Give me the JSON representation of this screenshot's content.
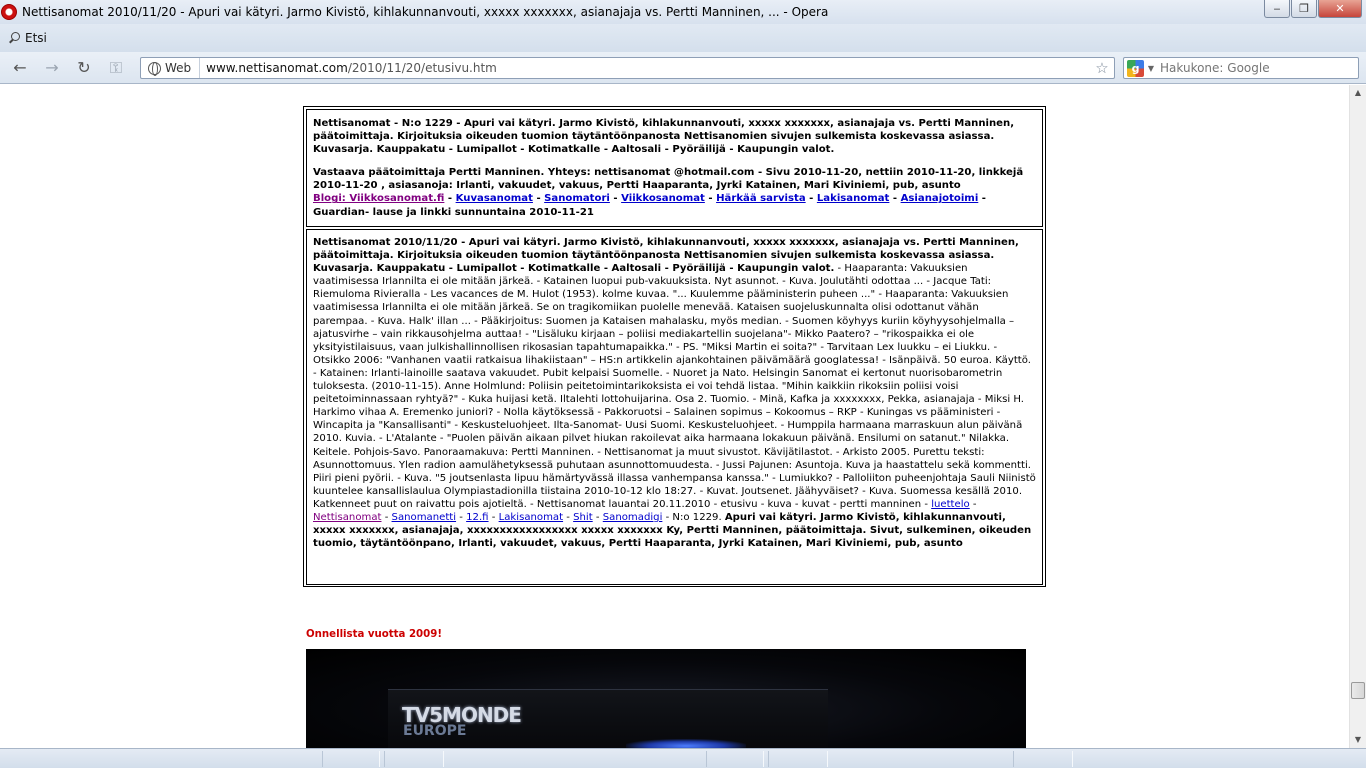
{
  "window": {
    "title": "Nettisanomat 2010/11/20 - Apuri vai kätyri. Jarmo Kivistö, kihlakunnanvouti, xxxxx xxxxxxx, asianajaja vs. Pertti Manninen, ... - Opera",
    "minimize": "‒",
    "restore": "❐",
    "close": "✕"
  },
  "menu": {
    "search_label": "Etsi"
  },
  "toolbar": {
    "back": "←",
    "forward": "→",
    "reload": "↻",
    "wand": "⚿",
    "web_label": "Web",
    "url_host": "www.nettisanomat.com",
    "url_path": "/2010/11/20/etusivu.htm",
    "star": "☆",
    "search_engine_letter": "g",
    "search_placeholder": "Hakukone: Google"
  },
  "page": {
    "box1": {
      "intro": "Nettisanomat - N:o 1229 - Apuri vai kätyri. Jarmo Kivistö, kihlakunnanvouti, xxxxx xxxxxxx, asianajaja vs. Pertti Manninen, päätoimittaja. Kirjoituksia oikeuden tuomion täytäntöönpanosta Nettisanomien sivujen sulkemista koskevassa asiassa. Kuvasarja. Kauppakatu - Lumipallot - Kotimatkalle - Aaltosali - Pyöräilijä - Kaupungin valot.",
      "contact": "Vastaava päätoimittaja Pertti Manninen. Yhteys: nettisanomat @hotmail.com - Sivu 2010-11-20, nettiin 2010-11-20, linkkejä 2010-11-20 , asiasanoja: Irlanti, vakuudet, vakuus, Pertti Haaparanta, Jyrki Katainen, Mari Kiviniemi, pub, asunto",
      "links": [
        "Blogi: Viikkosanomat.fi",
        "Kuvasanomat",
        "Sanomatori",
        "Viikkosanomat",
        "Härkää sarvista",
        "Lakisanomat",
        "Asianajotoimi"
      ],
      "sep": " - ",
      "trail_sep": " -",
      "outro": "Guardian- lause ja linkki sunnuntaina 2010-11-21"
    },
    "box2": {
      "lead": "Nettisanomat 2010/11/20 - Apuri vai kätyri. Jarmo Kivistö, kihlakunnanvouti, xxxxx xxxxxxx, asianajaja vs. Pertti Manninen, päätoimittaja. Kirjoituksia oikeuden tuomion täytäntöönpanosta Nettisanomien sivujen sulkemista koskevassa asiassa. Kuvasarja. Kauppakatu - Lumipallot - Kotimatkalle - Aaltosali - Pyöräilijä - Kaupungin valot.",
      "body": " - Haaparanta: Vakuuksien vaatimisessa Irlannilta ei ole mitään järkeä. - Katainen luopui pub-vakuuksista. Nyt asunnot. - Kuva. Joulutähti odottaa ... - Jacque Tati: Riemuloma Rivieralla - Les vacances de M. Hulot (1953). kolme kuvaa. \"... Kuulemme pääministerin puheen ...\" - Haaparanta: Vakuuksien vaatimisessa Irlannilta ei ole mitään järkeä. Se on tragikomiikan puolelle menevää. Kataisen suojeluskunnalta olisi odottanut vähän parempaa. - Kuva. Halk' illan ... - Pääkirjoitus: Suomen ja Kataisen mahalasku, myös median. - Suomen köyhyys kuriin köyhyysohjelmalla – ajatusvirhe – vain rikkausohjelma auttaa! - \"Lisäluku kirjaan – poliisi mediakartellin suojelana\"- Mikko Paatero? – \"rikospaikka ei ole yksityistilaisuus, vaan julkishallinnollisen rikosasian tapahtumapaikka.\" - PS. \"Miksi Martin ei soita?\" - Tarvitaan Lex luukku – ei Liukku. - Otsikko 2006: \"Vanhanen vaatii ratkaisua lihakiistaan\" – HS:n artikkelin ajankohtainen päivämäärä googlatessa! - Isänpäivä. 50 euroa. Käyttö. - Katainen: Irlanti-lainoille saatava vakuudet. Pubit kelpaisi Suomelle. - Nuoret ja Nato. Helsingin Sanomat ei kertonut nuorisobarometrin tuloksesta. (2010-11-15). Anne Holmlund: Poliisin peitetoimintarikoksista ei voi tehdä listaa. \"Mihin kaikkiin rikoksiin poliisi voisi peitetoiminnassaan ryhtyä?\" - Kuka huijasi ketä. Iltalehti lottohuijarina. Osa 2. Tuomio. - Minä, Kafka ja xxxxxxxx, Pekka, asianajaja - Miksi H. Harkimo vihaa A. Eremenko juniori? - Nolla käytöksessä - Pakkoruotsi – Salainen sopimus – Kokoomus – RKP - Kuningas vs pääministeri - Wincapita ja \"Kansallisanti\" - Keskusteluohjeet. Ilta-Sanomat- Uusi Suomi. Keskusteluohjeet. - Humppila harmaana marraskuun alun päivänä 2010. Kuvia. - L'Atalante - \"Puolen päivän aikaan pilvet hiukan rakoilevat aika harmaana lokakuun päivänä. Ensilumi on satanut.\" Nilakka. Keitele. Pohjois-Savo. Panoraamakuva: Pertti Manninen. - Nettisanomat ja muut sivustot. Kävijätilastot. - Arkisto 2005. Purettu teksti: Asunnottomuus. Ylen radion aamulähetyksessä puhutaan asunnottomuudesta. - Jussi Pajunen: Asuntoja. Kuva ja haastattelu sekä kommentti. Piiri pieni pyörii. - Kuva. \"5 joutsenlasta lipuu hämärtyvässä illassa vanhempansa kanssa.\" - Lumiukko? - Palloliiton puheenjohtaja Sauli Niinistö kuuntelee kansallislaulua Olympiastadionilla tiistaina 2010-10-12 klo 18:27. - Kuvat. Joutsenet. Jäähyväiset? - Kuva. Suomessa kesällä 2010. Katkenneet puut on raivattu pois ajotieltä. - Nettisanomat lauantai 20.11.2010 - etusivu - kuva - kuvat - pertti manninen - ",
      "links": [
        "luettelo",
        "Nettisanomat",
        "Sanomanetti",
        "12.fi",
        "Lakisanomat",
        "Shit",
        "Sanomadigi"
      ],
      "sep": " - ",
      "number": " - N:o 1229. ",
      "closing": "Apuri vai kätyri. Jarmo Kivistö, kihlakunnanvouti, xxxxx xxxxxxx, asianajaja, xxxxxxxxxxxxxxxxx xxxxx xxxxxxx Ky, Pertti Manninen, päätoimittaja. Sivut, sulkeminen, oikeuden tuomio, täytäntöönpano, Irlanti, vakuudet, vakuus, Pertti Haaparanta, Jyrki Katainen, Mari Kiviniemi, pub, asunto"
    },
    "greeting": "Onnellista vuotta 2009!",
    "photo_logo_top": "TV5MONDE",
    "photo_logo_bottom": "EUROPE"
  },
  "scrollbar": {
    "up": "▲",
    "down": "▼"
  }
}
